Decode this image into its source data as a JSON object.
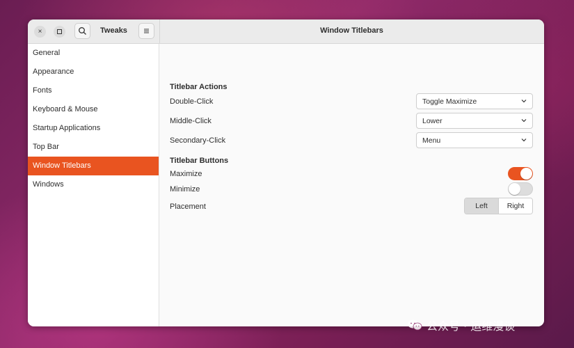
{
  "headerbar": {
    "close_icon": "×",
    "app_title": "Tweaks",
    "title": "Window Titlebars"
  },
  "sidebar": {
    "items": [
      {
        "label": "General"
      },
      {
        "label": "Appearance"
      },
      {
        "label": "Fonts"
      },
      {
        "label": "Keyboard & Mouse"
      },
      {
        "label": "Startup Applications"
      },
      {
        "label": "Top Bar"
      },
      {
        "label": "Window Titlebars",
        "active": true
      },
      {
        "label": "Windows"
      }
    ]
  },
  "content": {
    "actions_title": "Titlebar Actions",
    "double_click": {
      "label": "Double-Click",
      "value": "Toggle Maximize"
    },
    "middle_click": {
      "label": "Middle-Click",
      "value": "Lower"
    },
    "secondary_click": {
      "label": "Secondary-Click",
      "value": "Menu"
    },
    "buttons_title": "Titlebar Buttons",
    "maximize": {
      "label": "Maximize",
      "enabled": true
    },
    "minimize": {
      "label": "Minimize",
      "enabled": false
    },
    "placement": {
      "label": "Placement",
      "options": [
        "Left",
        "Right"
      ],
      "selected": "Left"
    }
  },
  "colors": {
    "accent": "#e95420"
  },
  "watermark": {
    "text": "公众号 · 运维漫谈"
  }
}
